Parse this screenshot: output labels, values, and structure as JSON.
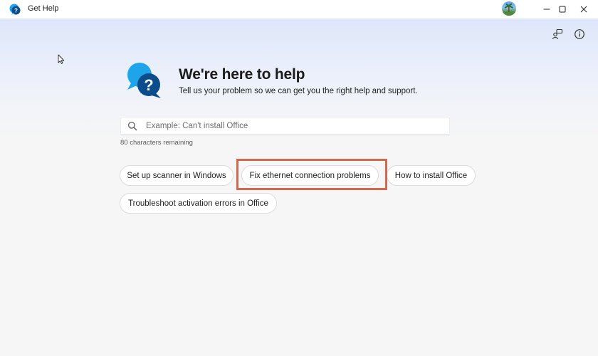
{
  "window": {
    "title": "Get Help"
  },
  "header": {
    "heading": "We're here to help",
    "subheading": "Tell us your problem so we can get you the right help and support."
  },
  "search": {
    "placeholder": "Example: Can't install Office",
    "value": "",
    "remaining": "80 characters remaining"
  },
  "suggestions": [
    "Set up scanner in Windows",
    "Fix ethernet connection problems",
    "How to install Office",
    "Troubleshoot activation errors in Office"
  ],
  "highlighted_suggestion": "Fix ethernet connection problems",
  "colors": {
    "accent": "#0f6cbd",
    "highlight": "#d06a4f",
    "hero_blue": "#1ea4e9",
    "hero_dark": "#0b4d8c"
  },
  "icons": {
    "app": "get-help-icon",
    "feedback": "feedback-icon",
    "info": "info-icon",
    "search": "search-icon",
    "hero": "help-chat-bubbles-icon"
  }
}
